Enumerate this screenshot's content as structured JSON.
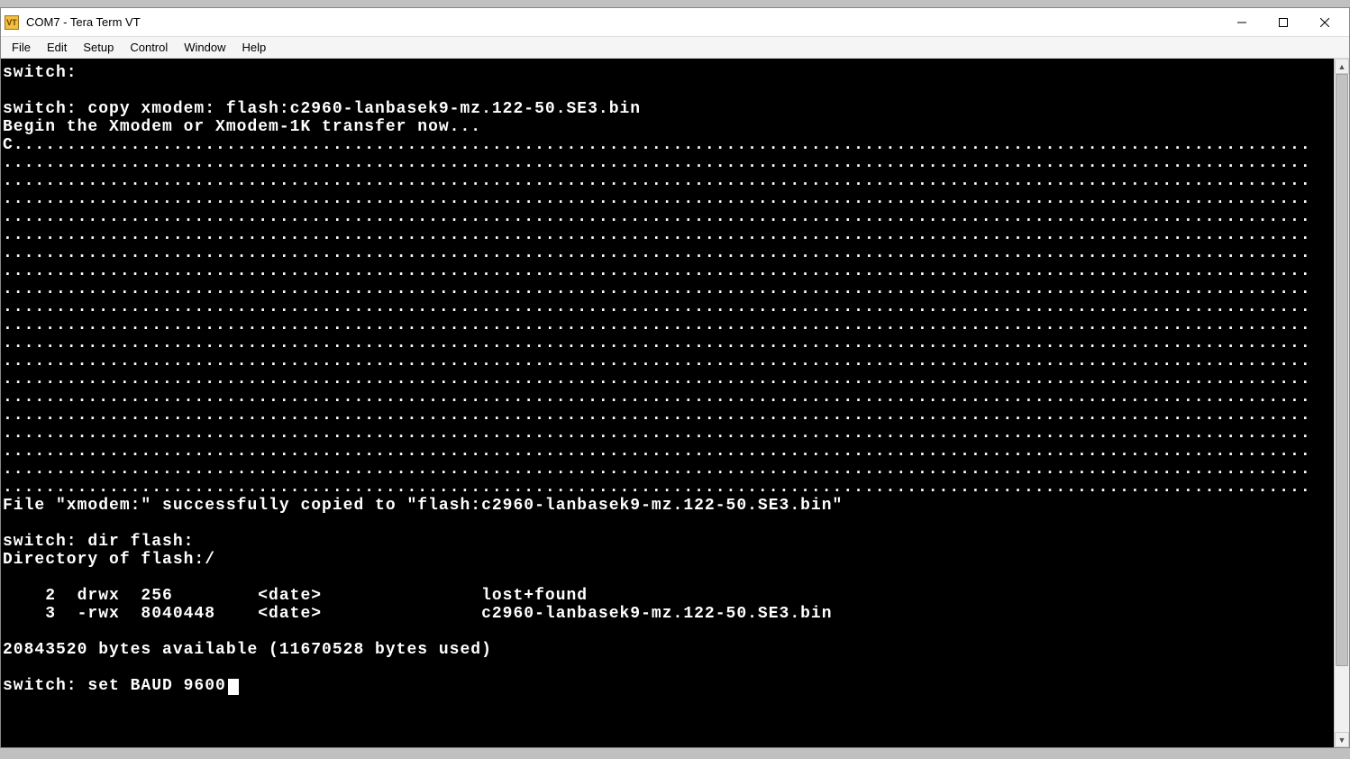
{
  "window": {
    "icon_text": "VT",
    "title": "COM7 - Tera Term VT"
  },
  "menu": {
    "file": "File",
    "edit": "Edit",
    "setup": "Setup",
    "control": "Control",
    "window": "Window",
    "help": "Help"
  },
  "terminal": {
    "prompt1": "switch:",
    "blank1": "",
    "cmd_copy": "switch: copy xmodem: flash:c2960-lanbasek9-mz.122-50.SE3.bin",
    "begin": "Begin the Xmodem or Xmodem-1K transfer now...",
    "dots_first": "C..........................................................................................................................",
    "dots": "...........................................................................................................................",
    "success": "File \"xmodem:\" successfully copied to \"flash:c2960-lanbasek9-mz.122-50.SE3.bin\"",
    "cmd_dir": "switch: dir flash:",
    "dir_header": "Directory of flash:/",
    "dir_row1": "    2  drwx  256        <date>               lost+found",
    "dir_row2": "    3  -rwx  8040448    <date>               c2960-lanbasek9-mz.122-50.SE3.bin",
    "bytes": "20843520 bytes available (11670528 bytes used)",
    "cmd_baud": "switch: set BAUD 9600",
    "progress_rows": 19
  }
}
